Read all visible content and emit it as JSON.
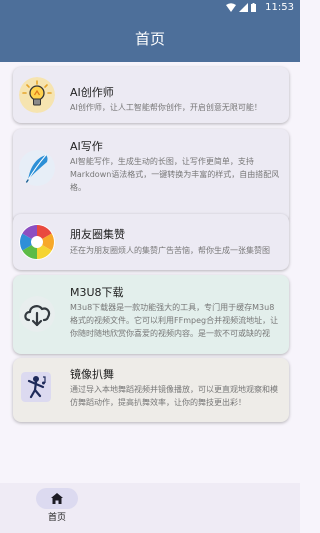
{
  "status_bar": {
    "time": "11:53",
    "icons": [
      "wifi-icon",
      "signal-icon",
      "battery-icon"
    ]
  },
  "app_bar": {
    "title": "首页"
  },
  "cards": [
    {
      "title": "AI创作师",
      "desc": "AI创作师，让人工智能帮你创作，开启创意无限可能！",
      "icon": "lightbulb-icon",
      "bg": "#eceaf3"
    },
    {
      "title": "AI写作",
      "desc": "AI智能写作，生成生动的长图，让写作更简单，支持Markdown语法格式，一键转换为丰富的样式，自由搭配风格。",
      "icon": "feather-icon",
      "bg": "#eceaf3"
    },
    {
      "title": "朋友圈集赞",
      "desc": "还在为朋友圈烦人的集赞广告苦恼，帮你生成一张集赞图",
      "icon": "camera-aperture-icon",
      "bg": "#eceaf3"
    },
    {
      "title": "M3U8下载",
      "desc": "M3u8下载器是一款功能强大的工具，专门用于缓存M3u8格式的视频文件。它可以利用FFmpeg合并视频流地址，让你随时随地欣赏你喜爱的视频内容。是一款不可或缺的视频...",
      "icon": "cloud-download-icon",
      "bg": "#e3efec"
    },
    {
      "title": "镜像扒舞",
      "desc": "通过导入本地舞蹈视频并镜像播放，可以更直观地观察和模仿舞蹈动作，提高扒舞效率，让你的舞技更出彩！",
      "icon": "dancer-icon",
      "bg": "#eeece8"
    }
  ],
  "bottom_nav": {
    "items": [
      {
        "label": "首页",
        "icon": "home-icon",
        "active": true
      }
    ]
  },
  "colors": {
    "app_bar": "#4d6f9a",
    "background": "#f7f4fb",
    "nav_bg": "#efebf5",
    "nav_active_pill": "#dcdaf0"
  }
}
